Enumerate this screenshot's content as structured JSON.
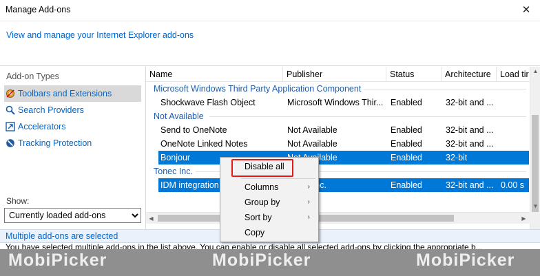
{
  "window": {
    "title": "Manage Add-ons",
    "close_glyph": "✕"
  },
  "header": {
    "link_text": "View and manage your Internet Explorer add-ons"
  },
  "sidebar": {
    "types_label": "Add-on Types",
    "items": [
      {
        "label": "Toolbars and Extensions",
        "icon": "toolbars-extensions-icon"
      },
      {
        "label": "Search Providers",
        "icon": "search-providers-icon"
      },
      {
        "label": "Accelerators",
        "icon": "accelerators-icon"
      },
      {
        "label": "Tracking Protection",
        "icon": "tracking-protection-icon"
      }
    ],
    "show_label": "Show:",
    "show_value": "Currently loaded add-ons"
  },
  "list": {
    "columns": [
      "Name",
      "Publisher",
      "Status",
      "Architecture",
      "Load tir"
    ],
    "sort_glyph": "^",
    "groups": [
      {
        "name": "Microsoft Windows Third Party Application Component",
        "rows": [
          {
            "name": "Shockwave Flash Object",
            "publisher": "Microsoft Windows Thir...",
            "status": "Enabled",
            "arch": "32-bit and ...",
            "load": ""
          }
        ]
      },
      {
        "name": "Not Available",
        "rows": [
          {
            "name": "Send to OneNote",
            "publisher": "Not Available",
            "status": "Enabled",
            "arch": "32-bit and ...",
            "load": ""
          },
          {
            "name": "OneNote Linked Notes",
            "publisher": "Not Available",
            "status": "Enabled",
            "arch": "32-bit and ...",
            "load": ""
          },
          {
            "name": "Bonjour",
            "publisher": "Not Available",
            "status": "Enabled",
            "arch": "32-bit",
            "load": ""
          }
        ]
      },
      {
        "name": "Tonec Inc.",
        "rows": [
          {
            "name": "IDM integration",
            "publisher": "Tonec Inc.",
            "status": "Enabled",
            "arch": "32-bit and ...",
            "load": "0.00 s"
          }
        ]
      }
    ]
  },
  "context_menu": {
    "items": [
      "Disable all",
      "Columns",
      "Group by",
      "Sort by",
      "Copy"
    ],
    "submenu_glyph": "›"
  },
  "details": {
    "header": "Multiple add-ons are selected",
    "message": "You have selected multiple add-ons in the list above. You can enable or disable all selected add-ons by clicking the appropriate b..."
  },
  "watermark": {
    "text": "MobiPicker"
  },
  "colors": {
    "link": "#0066cc",
    "selection": "#0078d7",
    "annotation": "#e01818"
  }
}
